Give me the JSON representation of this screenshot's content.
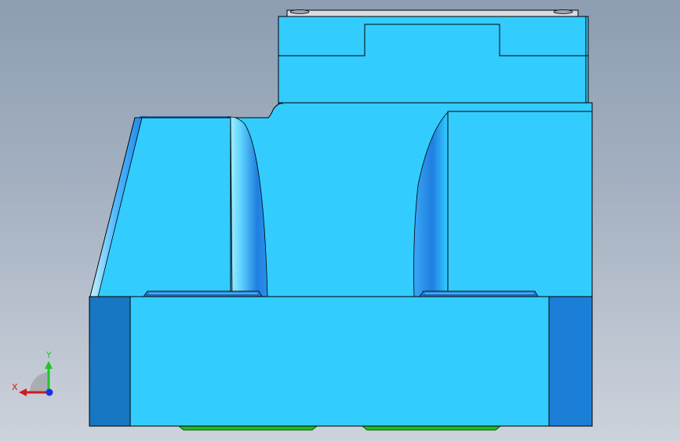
{
  "viewport": {
    "background_top": "#8d9db2",
    "background_bottom": "#cdd3dc"
  },
  "model": {
    "face_color": "#33ccff",
    "side_face_color": "#1877c2",
    "side_face_color_right": "#1b7fd8",
    "edge_color": "#000000",
    "pad_color": "#22bb22"
  },
  "triad": {
    "x_label": "X",
    "y_label": "Y",
    "x_color": "#d11a1a",
    "y_color": "#22c42a",
    "z_color": "#1a2fe0"
  }
}
